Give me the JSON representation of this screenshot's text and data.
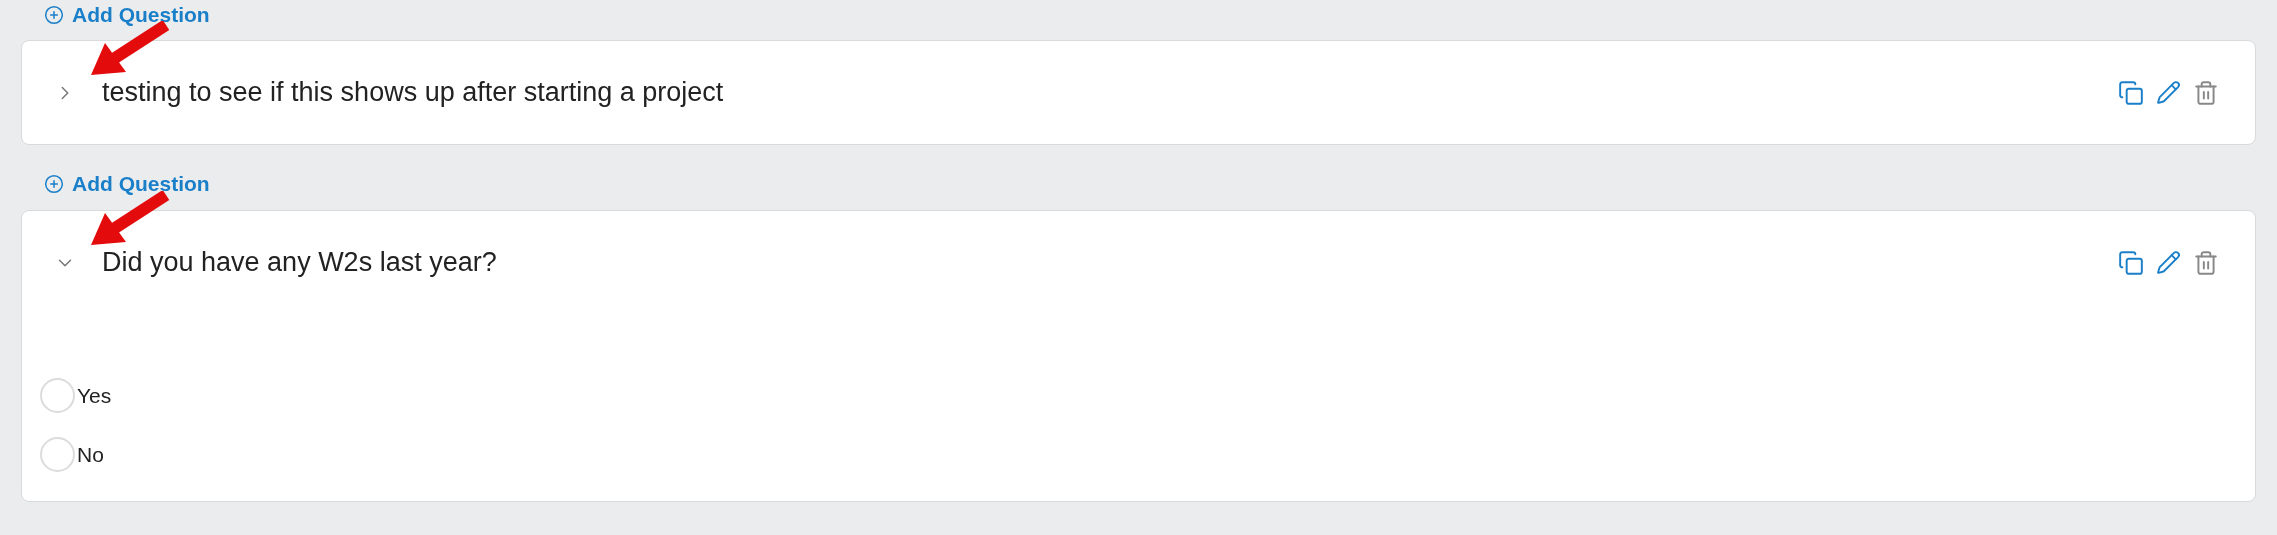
{
  "items": [
    {
      "kind": "add",
      "label": "Add Question"
    },
    {
      "kind": "question",
      "title": "testing to see if this shows up after starting a project",
      "expanded": false
    },
    {
      "kind": "add",
      "label": "Add Question"
    },
    {
      "kind": "question",
      "title": "Did you have any W2s last year?",
      "expanded": true,
      "options": [
        {
          "label": "Yes",
          "selected": false
        },
        {
          "label": "No",
          "selected": false
        }
      ]
    }
  ]
}
